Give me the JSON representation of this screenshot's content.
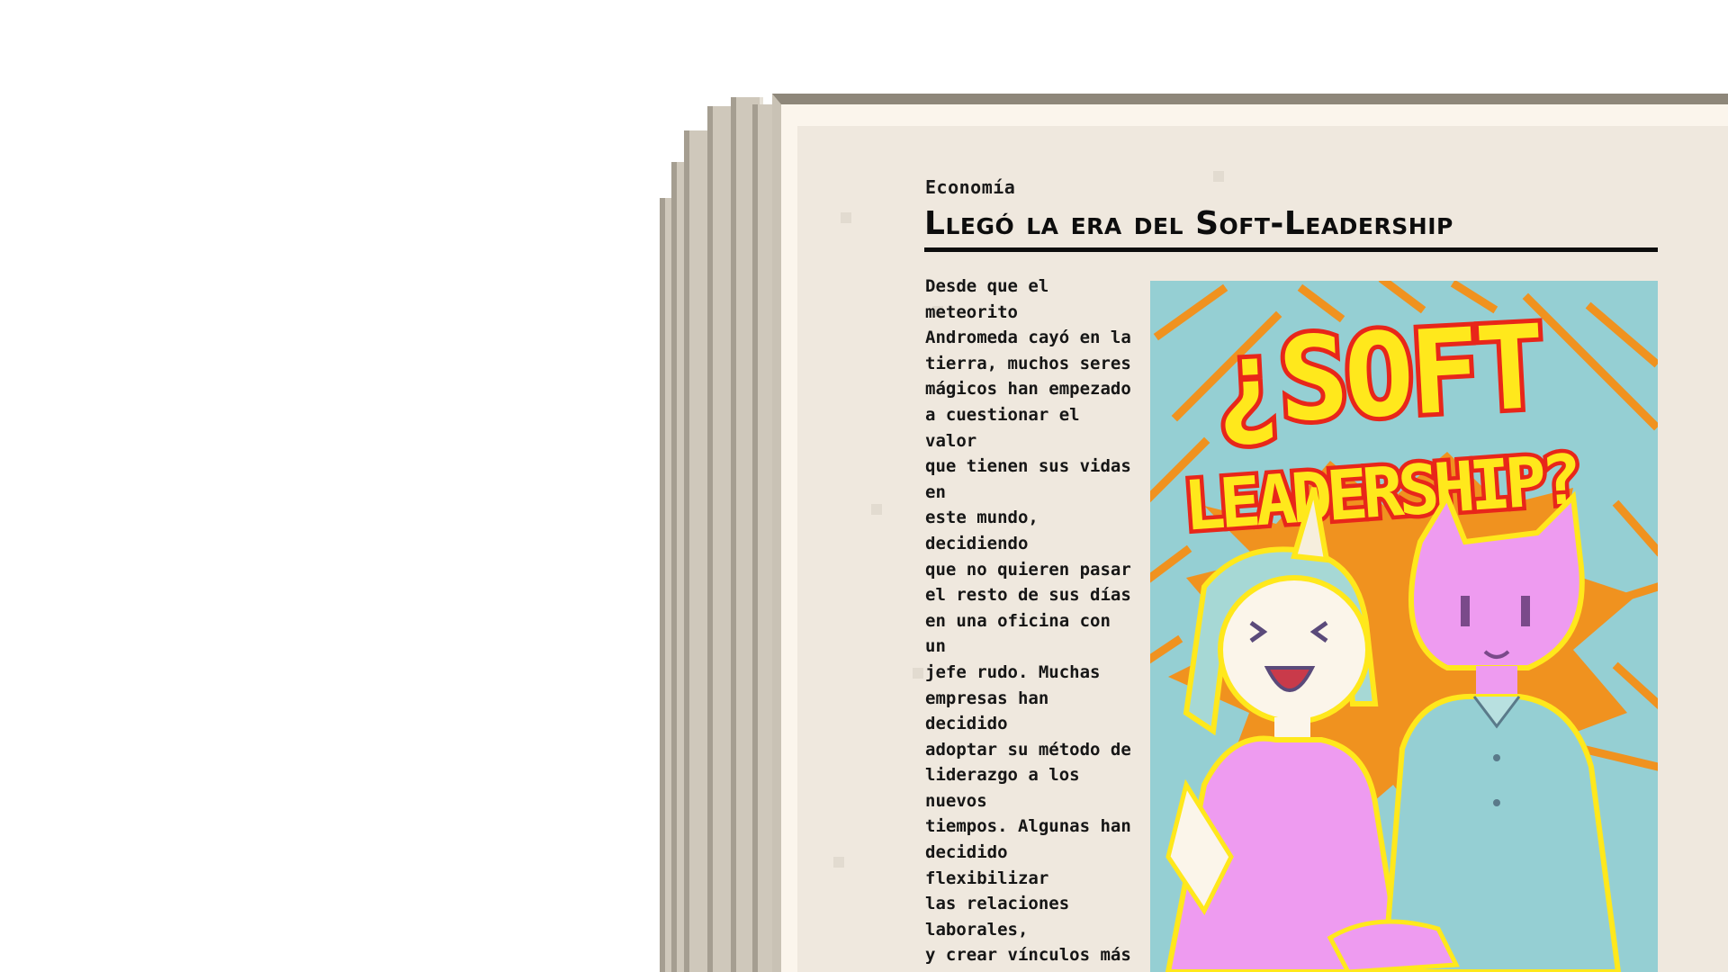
{
  "article": {
    "section": "Economía",
    "headline": "Llegó la era del Soft-Leadership",
    "body": "Desde que el meteorito\nAndromeda cayó en la\ntierra, muchos seres\nmágicos han empezado\na cuestionar el valor\nque tienen sus vidas en\neste mundo, decidiendo\nque no quieren pasar\nel resto de sus días\nen una oficina con un\njefe rudo. Muchas\nempresas han decidido\nadoptar su método de\nliderazgo a los nuevos\ntiempos. Algunas han\ndecidido flexibilizar\nlas relaciones laborales,\ny crear vínculos más\nafectivos y casuales\nentre jefe y empleado,\ncomo es el caso de la\nempresa “Mermaid\nMattresses”, la cual\nestá muy contenta con\nlos resultados. Hilda\nCoral de la extensa\nfamilia Coral, nos da"
  },
  "illustration": {
    "title_line1": "¿SOFT",
    "title_line2": "LEADERSHIP?",
    "characters": [
      "unicorn-woman",
      "cat-man"
    ],
    "colors": {
      "background_teal": "#95cfd3",
      "burst_orange": "#f0921f",
      "title_fill": "#ffe81c",
      "title_outline": "#e8261a",
      "character_pink": "#ee9bf0",
      "outline_yellow": "#ffe81c",
      "hair_teal": "#a6d8d5",
      "shirt_teal": "#95cfd3"
    }
  }
}
